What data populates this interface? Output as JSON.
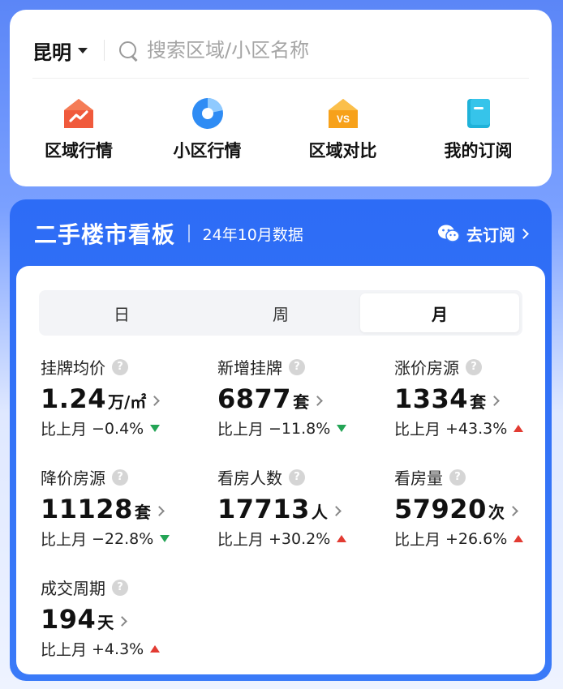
{
  "search": {
    "city": "昆明",
    "placeholder": "搜索区域/小区名称"
  },
  "nav": [
    {
      "label": "区域行情",
      "icon": "area-trend-icon"
    },
    {
      "label": "小区行情",
      "icon": "community-trend-icon"
    },
    {
      "label": "区域对比",
      "icon": "area-compare-icon"
    },
    {
      "label": "我的订阅",
      "icon": "my-subscription-icon"
    }
  ],
  "board": {
    "title": "二手楼市看板",
    "subtitle": "24年10月数据",
    "subscribe_label": "去订阅",
    "tabs": [
      {
        "label": "日",
        "active": false
      },
      {
        "label": "周",
        "active": false
      },
      {
        "label": "月",
        "active": true
      }
    ],
    "compare_prefix": "比上月",
    "stats": [
      {
        "label": "挂牌均价",
        "value": "1.24",
        "unit": "万/㎡",
        "change": "−0.4%",
        "direction": "down"
      },
      {
        "label": "新增挂牌",
        "value": "6877",
        "unit": "套",
        "change": "−11.8%",
        "direction": "down"
      },
      {
        "label": "涨价房源",
        "value": "1334",
        "unit": "套",
        "change": "+43.3%",
        "direction": "up"
      },
      {
        "label": "降价房源",
        "value": "11128",
        "unit": "套",
        "change": "−22.8%",
        "direction": "down"
      },
      {
        "label": "看房人数",
        "value": "17713",
        "unit": "人",
        "change": "+30.2%",
        "direction": "up"
      },
      {
        "label": "看房量",
        "value": "57920",
        "unit": "次",
        "change": "+26.6%",
        "direction": "up"
      },
      {
        "label": "成交周期",
        "value": "194",
        "unit": "天",
        "change": "+4.3%",
        "direction": "up"
      }
    ]
  },
  "colors": {
    "brand_blue": "#2d6cf6",
    "down_green": "#23a455",
    "up_red": "#e23b32"
  }
}
